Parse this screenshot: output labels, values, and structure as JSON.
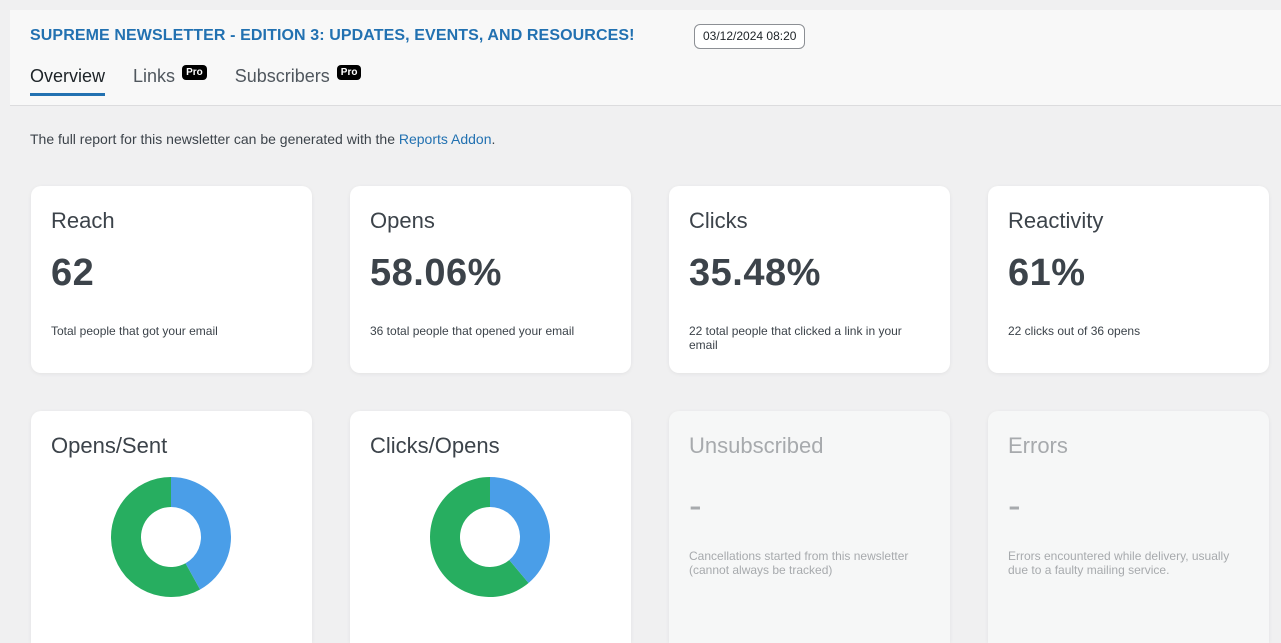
{
  "header": {
    "title": "SUPREME NEWSLETTER - EDITION 3: UPDATES, EVENTS, AND RESOURCES!",
    "date": "03/12/2024 08:20",
    "tabs": [
      {
        "label": "Overview",
        "active": true,
        "badge": ""
      },
      {
        "label": "Links",
        "active": false,
        "badge": "Pro"
      },
      {
        "label": "Subscribers",
        "active": false,
        "badge": "Pro"
      }
    ]
  },
  "notice": {
    "text": "The full report for this newsletter can be generated with the ",
    "link": "Reports Addon",
    "suffix": "."
  },
  "stats": {
    "reach": {
      "label": "Reach",
      "value": "62",
      "desc": "Total people that got your email"
    },
    "opens": {
      "label": "Opens",
      "value": "58.06%",
      "desc": "36 total people that opened your email"
    },
    "clicks": {
      "label": "Clicks",
      "value": "35.48%",
      "desc": "22 total people that clicked a link in your email"
    },
    "reactivity": {
      "label": "Reactivity",
      "value": "61%",
      "desc": "22 clicks out of 36 opens"
    }
  },
  "charts": {
    "opens_sent": {
      "label": "Opens/Sent",
      "fraction": 0.4194
    },
    "clicks_opens": {
      "label": "Clicks/Opens",
      "fraction": 0.3889
    }
  },
  "other": {
    "unsubscribed": {
      "label": "Unsubscribed",
      "value": "-",
      "desc": "Cancellations started from this newsletter (cannot always be tracked)"
    },
    "errors": {
      "label": "Errors",
      "value": "-",
      "desc": "Errors encountered while delivery, usually due to a faulty mailing service."
    }
  },
  "colors": {
    "primary": "#2271b1",
    "blue": "#4a9ee8",
    "green": "#27ae60"
  }
}
